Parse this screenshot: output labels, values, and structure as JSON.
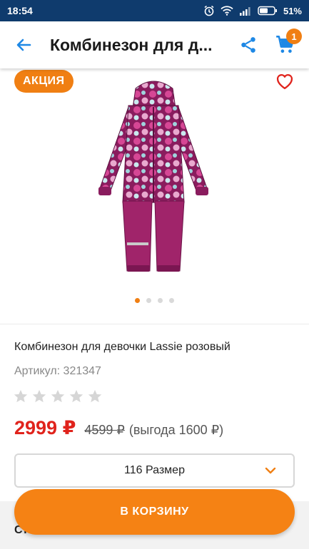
{
  "status_bar": {
    "time": "18:54",
    "battery_percent": "51%",
    "icons": [
      "alarm-icon",
      "wifi-icon",
      "signal-icon",
      "battery-icon"
    ]
  },
  "app_bar": {
    "title": "Комбинезон для д...",
    "cart_count": "1",
    "icons": [
      "back-arrow-icon",
      "share-icon",
      "cart-icon"
    ]
  },
  "gallery": {
    "sale_badge": "АКЦИЯ",
    "image_count": 4,
    "active_index": 0,
    "icons": [
      "heart-icon"
    ]
  },
  "product": {
    "name": "Комбинезон для девочки Lassie розовый",
    "article": "Артикул: 321347",
    "rating": 0,
    "rating_max": 5,
    "price_new": "2999 ₽",
    "price_old": "4599 ₽",
    "price_benefit": "(выгода 1600 ₽)"
  },
  "size_select": {
    "value": "116 Размер"
  },
  "buy_button": {
    "label": "В КОРЗИНУ"
  },
  "bottom": {
    "partial_text": "Ст"
  },
  "colors": {
    "accent": "#f07f13",
    "button": "#f58214",
    "price": "#e0231c",
    "link_blue": "#1e88e5",
    "status_bar": "#0f3b6d"
  }
}
